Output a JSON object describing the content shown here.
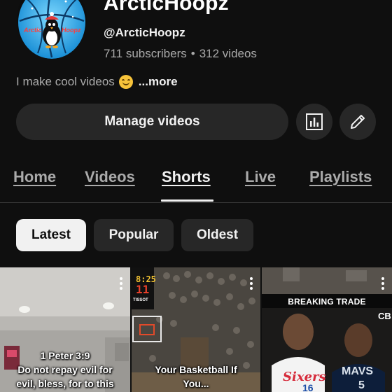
{
  "channel": {
    "name": "ArcticHoopz",
    "handle": "@ArcticHoopz",
    "subscribers": "711 subscribers",
    "separator": "•",
    "videos": "312 videos",
    "avatar_text_left": "Arctic",
    "avatar_text_right": "Hoopz",
    "description": "I make cool videos",
    "more_label": "...more"
  },
  "actions": {
    "manage_label": "Manage videos",
    "analytics_icon": "bar-chart-icon",
    "edit_icon": "pencil-icon"
  },
  "tabs": [
    {
      "label": "Home",
      "active": false
    },
    {
      "label": "Videos",
      "active": false
    },
    {
      "label": "Shorts",
      "active": true
    },
    {
      "label": "Live",
      "active": false
    },
    {
      "label": "Playlists",
      "active": false
    }
  ],
  "filters": [
    {
      "label": "Latest",
      "selected": true
    },
    {
      "label": "Popular",
      "selected": false
    },
    {
      "label": "Oldest",
      "selected": false
    }
  ],
  "shorts": [
    {
      "caption_line1": "1 Peter 3:9",
      "caption_line2": "Do not repay evil for",
      "caption_line3": "evil, bless, for to this"
    },
    {
      "shot_clock_time": "8:25",
      "shot_clock_seconds": "11",
      "sponsor": "TISSOT",
      "caption_line1": "Your Basketball If",
      "caption_line2": "You..."
    },
    {
      "headline": "BREAKING TRADE",
      "corner_logo": "CB",
      "jersey_left_team": "Sixers",
      "jersey_left_number": "16",
      "jersey_right_team": "MAVS",
      "jersey_right_number": "5"
    }
  ],
  "colors": {
    "background": "#0f0f0f",
    "chip": "#272727",
    "text_primary": "#f1f1f1",
    "text_secondary": "#aaaaaa"
  }
}
